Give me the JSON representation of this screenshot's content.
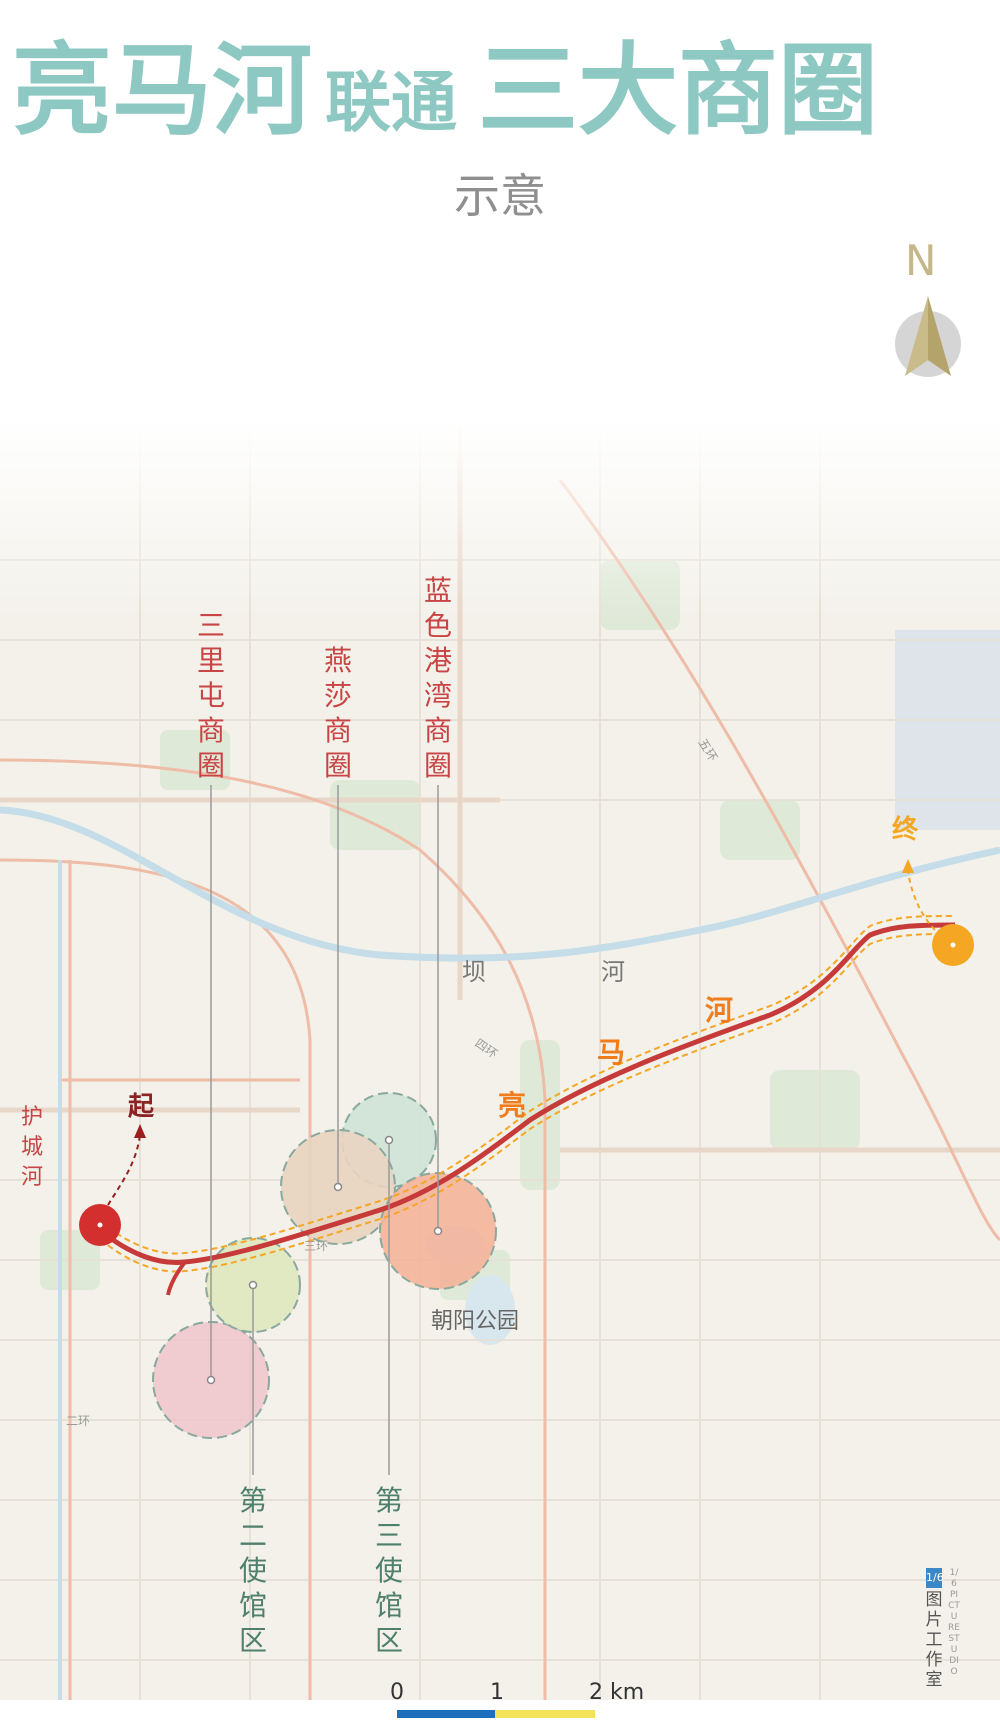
{
  "title": {
    "part1": "亮马河",
    "part2": "联通",
    "part3": "三大商圈"
  },
  "subtitle": "示意",
  "compass": {
    "letter": "N",
    "icon": "north-arrow-icon"
  },
  "labels": {
    "sanlitun": "三里屯商圈",
    "yansha": "燕莎商圈",
    "lansegangwan": "蓝色港湾商圈",
    "embassy2": "第二使馆区",
    "embassy3": "第三使馆区",
    "bahe_1": "坝",
    "bahe_2": "河",
    "liangmahe_1": "亮",
    "liangmahe_2": "马",
    "liangmahe_3": "河",
    "huchenghe": "护城河",
    "start": "起",
    "end": "终",
    "chaoyang_park": "朝阳公园",
    "ring2": "二环",
    "ring3": "三环",
    "ring4": "四环",
    "ring5": "五环"
  },
  "scale_bar": {
    "tick0": "0",
    "tick1": "1",
    "tick2": "2 km"
  },
  "credit": {
    "logo_text": "1/6",
    "cn": "图片工作室",
    "en": "1/6 PICTURE STUDIO"
  },
  "colors": {
    "title": "#8ec8c2",
    "river_liangma": "#c63a3a",
    "route_dash": "#f5a623",
    "label_orange": "#f07c1c",
    "label_red": "#c94444",
    "label_green": "#4f7f6d",
    "start_marker": "#d32f2f",
    "end_marker": "#f5a623",
    "scale_blue": "#1c6fba",
    "scale_yellow": "#f4e25b"
  }
}
